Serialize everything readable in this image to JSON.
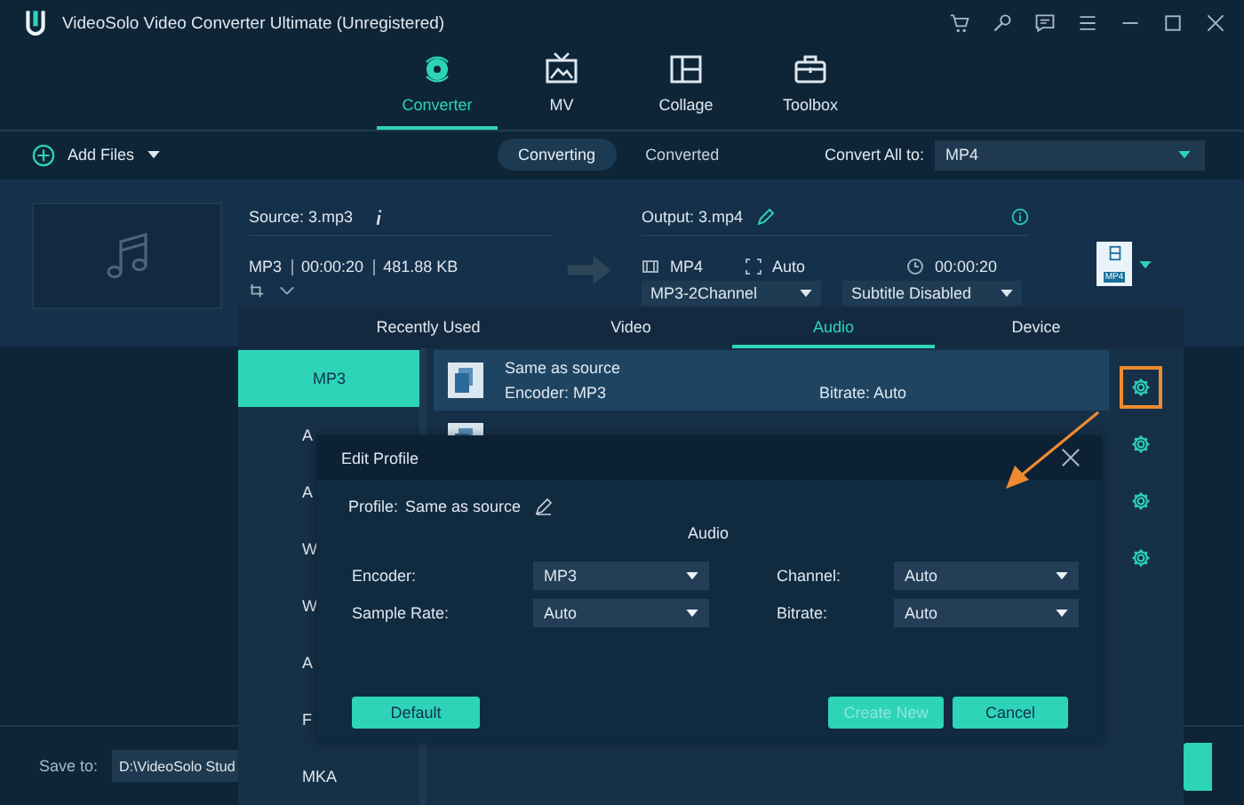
{
  "window": {
    "title": "VideoSolo Video Converter Ultimate (Unregistered)"
  },
  "nav_tabs": [
    {
      "label": "Converter",
      "selected": true
    },
    {
      "label": "MV",
      "selected": false
    },
    {
      "label": "Collage",
      "selected": false
    },
    {
      "label": "Toolbox",
      "selected": false
    }
  ],
  "toolbar": {
    "add_files": "Add Files",
    "view_tabs": [
      {
        "label": "Converting",
        "selected": true
      },
      {
        "label": "Converted",
        "selected": false
      }
    ],
    "convert_all_label": "Convert All to:",
    "convert_all_value": "MP4"
  },
  "file": {
    "source": "Source: 3.mp3",
    "format": "MP3",
    "duration": "00:00:20",
    "size": "481.88 KB",
    "output": "Output: 3.mp4",
    "out_format": "MP4",
    "resolution": "Auto",
    "out_duration": "00:00:20",
    "audio_track": "MP3-2Channel",
    "subtitle": "Subtitle Disabled",
    "format_badge": "MP4"
  },
  "format_panel": {
    "tabs": [
      {
        "label": "Recently Used",
        "selected": false
      },
      {
        "label": "Video",
        "selected": false
      },
      {
        "label": "Audio",
        "selected": true
      },
      {
        "label": "Device",
        "selected": false
      }
    ],
    "categories": [
      {
        "label": "MP3",
        "selected": true
      },
      {
        "label": "A",
        "selected": false
      },
      {
        "label": "A",
        "selected": false
      },
      {
        "label": "W",
        "selected": false
      },
      {
        "label": "W",
        "selected": false
      },
      {
        "label": "A",
        "selected": false
      },
      {
        "label": "F",
        "selected": false
      },
      {
        "label": "MKA",
        "selected": false
      }
    ],
    "profiles": [
      {
        "name": "Same as source",
        "encoder": "Encoder: MP3",
        "bitrate": "Bitrate: Auto",
        "selected": true
      },
      {
        "selected": false
      }
    ],
    "settings_buttons": [
      {
        "highlighted": true
      },
      {
        "highlighted": false
      },
      {
        "highlighted": false
      },
      {
        "highlighted": false
      }
    ]
  },
  "edit_profile": {
    "title": "Edit Profile",
    "profile_label": "Profile:",
    "profile_name": "Same as source",
    "section": "Audio",
    "fields": [
      {
        "label": "Encoder:",
        "value": "MP3"
      },
      {
        "label": "Channel:",
        "value": "Auto"
      },
      {
        "label": "Sample Rate:",
        "value": "Auto"
      },
      {
        "label": "Bitrate:",
        "value": "Auto"
      }
    ],
    "buttons": [
      {
        "label": "Default",
        "disabled": false
      },
      {
        "label": "Create New",
        "disabled": true
      },
      {
        "label": "Cancel",
        "disabled": false
      }
    ]
  },
  "save_bar": {
    "label": "Save to:",
    "path": "D:\\VideoSolo Stud"
  }
}
